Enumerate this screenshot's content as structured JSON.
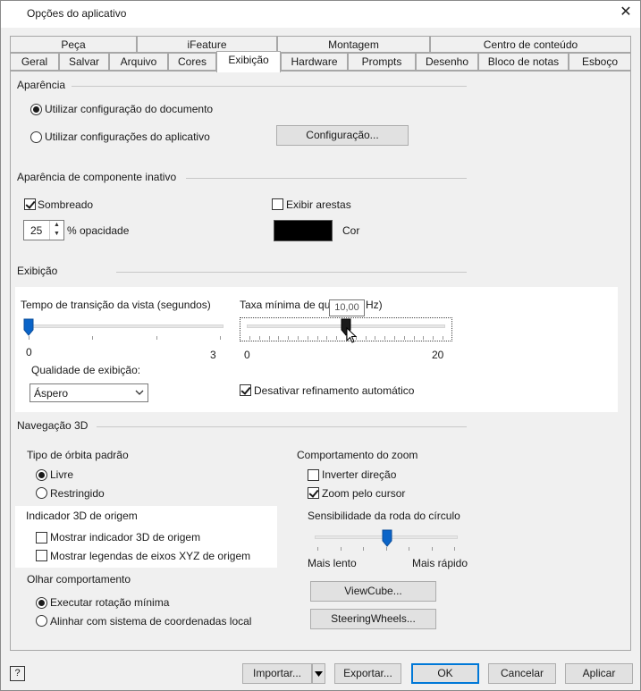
{
  "window": {
    "title": "Opções do aplicativo",
    "close_glyph": "✕"
  },
  "tabs": {
    "row1": [
      "Peça",
      "iFeature",
      "Montagem",
      "Centro de conteúdo"
    ],
    "row2": [
      "Geral",
      "Salvar",
      "Arquivo",
      "Cores",
      "Exibição",
      "Hardware",
      "Prompts",
      "Desenho",
      "Bloco de notas",
      "Esboço"
    ],
    "active": "Exibição"
  },
  "appearance": {
    "group_label": "Aparência",
    "use_document": "Utilizar configuração do documento",
    "use_app": "Utilizar configurações do aplicativo",
    "selected": "use_document",
    "config_button": "Configuração..."
  },
  "inactive": {
    "group_label": "Aparência de componente inativo",
    "shaded_label": "Sombreado",
    "shaded_checked": true,
    "edges_label": "Exibir arestas",
    "edges_checked": false,
    "opacity_value": "25",
    "opacity_label": "% opacidade",
    "color_label": "Cor",
    "color_value": "#000000"
  },
  "display": {
    "group_label": "Exibição",
    "transition_label": "Tempo de transição da vista (segundos)",
    "transition_min": "0",
    "transition_max": "3",
    "transition_value": 0,
    "framerate_label_left": "Taxa mínima de qu",
    "framerate_label_right": "Hz)",
    "framerate_min": "0",
    "framerate_max": "20",
    "framerate_value": 10,
    "framerate_tooltip": "10,00",
    "quality_label": "Qualidade de exibição:",
    "quality_value": "Áspero",
    "disable_refine_label": "Desativar refinamento automático",
    "disable_refine_checked": true
  },
  "nav3d": {
    "group_label": "Navegação 3D",
    "orbit_label": "Tipo de órbita padrão",
    "orbit_free": "Livre",
    "orbit_constrained": "Restringido",
    "orbit_selected": "free",
    "origin_label": "Indicador 3D de origem",
    "show_origin": "Mostrar indicador 3D de origem",
    "show_axis": "Mostrar legendas de eixos XYZ de origem",
    "look_label": "Olhar comportamento",
    "look_min_rotation": "Executar rotação mínima",
    "look_align": "Alinhar com sistema de coordenadas local",
    "look_selected": "min_rotation",
    "zoom_label": "Comportamento do zoom",
    "zoom_invert": "Inverter direção",
    "zoom_invert_checked": false,
    "zoom_cursor": "Zoom pelo cursor",
    "zoom_cursor_checked": true,
    "wheel_label": "Sensibilidade da roda do círculo",
    "wheel_slow": "Mais lento",
    "wheel_fast": "Mais rápido",
    "wheel_value_fraction": 0.5,
    "viewcube_button": "ViewCube...",
    "steering_button": "SteeringWheels..."
  },
  "footer": {
    "help_icon": "?",
    "import_button": "Importar...",
    "export_button": "Exportar...",
    "ok_button": "OK",
    "cancel_button": "Cancelar",
    "apply_button": "Aplicar"
  }
}
